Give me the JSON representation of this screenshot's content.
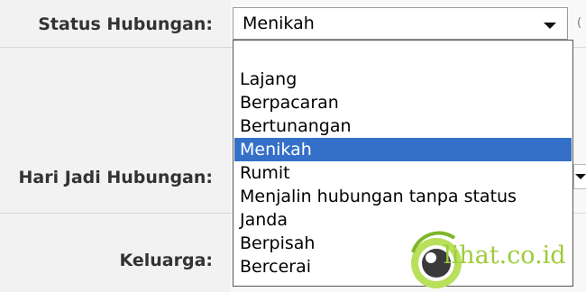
{
  "form": {
    "status": {
      "label": "Status Hubungan:",
      "selected": "Menikah",
      "trailing": "("
    },
    "anniversary": {
      "label": "Hari Jadi Hubungan:"
    },
    "family": {
      "label": "Keluarga:"
    }
  },
  "dropdown": {
    "options": [
      "",
      "Lajang",
      "Berpacaran",
      "Bertunangan",
      "Menikah",
      "Rumit",
      "Menjalin hubungan tanpa status",
      "Janda",
      "Berpisah",
      "Bercerai"
    ],
    "selected_index": 4,
    "highlight_color": "#3470c8"
  },
  "watermark": {
    "text": "lihat.co.id",
    "color": "#9ccc3a"
  }
}
